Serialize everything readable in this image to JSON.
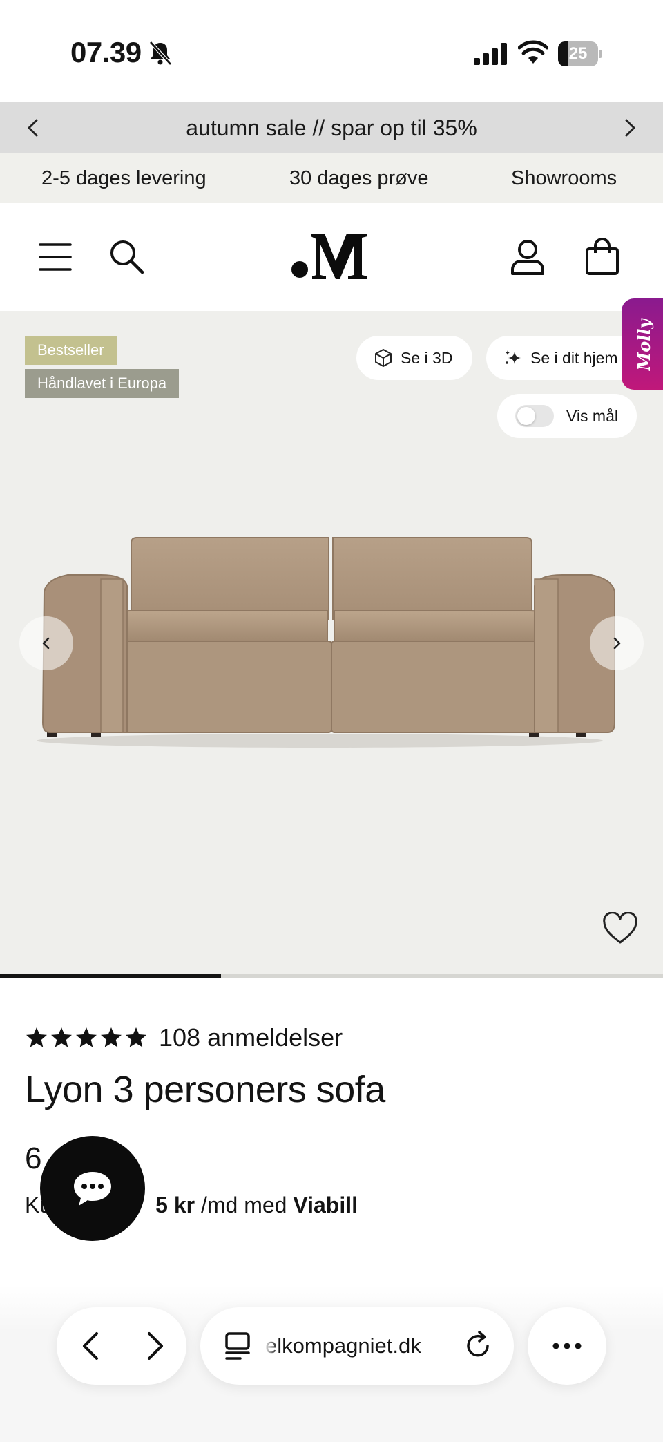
{
  "status_bar": {
    "time": "07.39",
    "battery": "25",
    "battery_level": 0.25
  },
  "promo": {
    "text": "autumn sale // spar op til 35%"
  },
  "usp": {
    "items": [
      "2-5 dages levering",
      "30 dages prøve",
      "Showrooms"
    ]
  },
  "header": {
    "logo_text": ".M"
  },
  "molly": {
    "label": "Molly"
  },
  "gallery": {
    "badges": [
      "Bestseller",
      "Håndlavet i Europa"
    ],
    "btn_3d": "Se i 3D",
    "btn_home": "Se i dit hjem",
    "btn_measure": "Vis mål",
    "measure_toggle_on": false,
    "slide_progress": 0.333
  },
  "product": {
    "rating_stars": 5,
    "reviews": "108 anmeldelser",
    "title": "Lyon 3 personers sofa",
    "price_visible": "6",
    "installment_prefix": "Ku",
    "installment_amount": "5 kr",
    "installment_suffix": "/md med",
    "installment_provider": "Viabill"
  },
  "browser": {
    "url": "elkompagniet.dk"
  },
  "colors": {
    "promo_bg": "#dcdcdc",
    "usp_bg": "#f0f0ec",
    "badge_bestseller": "#c3c18f",
    "badge_handmade": "#9b9c8e",
    "gallery_bg": "#efefec",
    "molly_gradient_start": "#8a1a8e",
    "molly_gradient_end": "#c0187a",
    "sofa": "#b29b83"
  },
  "icons": [
    "bell-slash-icon",
    "signal-icon",
    "wifi-icon",
    "battery-icon",
    "chevron-left-icon",
    "chevron-right-icon",
    "menu-icon",
    "search-icon",
    "user-icon",
    "bag-icon",
    "cube-icon",
    "sparkle-icon",
    "heart-icon",
    "star-icon",
    "chat-icon",
    "tabs-icon",
    "reload-icon",
    "more-icon"
  ]
}
